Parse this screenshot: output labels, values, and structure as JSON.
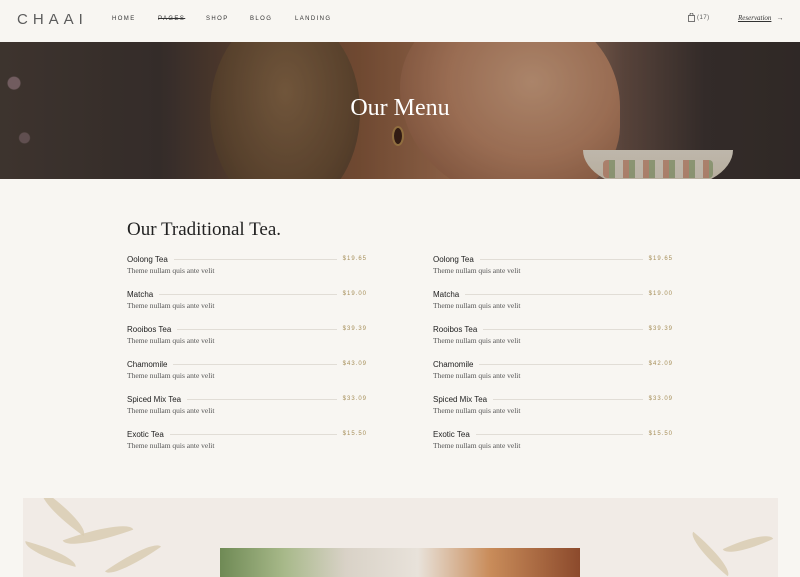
{
  "header": {
    "logo": "CHAAI",
    "nav": {
      "home": "HOME",
      "pages": "PAGES",
      "shop": "SHOP",
      "blog": "BLOG",
      "landing": "LANDING"
    },
    "cart_count": "(17)",
    "reservation": "Reservation",
    "reservation_arrow": "→"
  },
  "hero": {
    "title": "Our Menu"
  },
  "menu": {
    "title": "Our Traditional Tea.",
    "left": [
      {
        "name": "Oolong Tea",
        "price": "$19.65",
        "desc": "Theme nullam quis ante velit"
      },
      {
        "name": "Matcha",
        "price": "$19.00",
        "desc": "Theme nullam quis ante velit"
      },
      {
        "name": "Rooibos Tea",
        "price": "$39.39",
        "desc": "Theme nullam quis ante velit"
      },
      {
        "name": "Chamomile",
        "price": "$43.09",
        "desc": "Theme nullam quis ante velit"
      },
      {
        "name": "Spiced Mix Tea",
        "price": "$33.09",
        "desc": "Theme nullam quis ante velit"
      },
      {
        "name": "Exotic Tea",
        "price": "$15.50",
        "desc": "Theme nullam quis ante velit"
      }
    ],
    "right": [
      {
        "name": "Oolong Tea",
        "price": "$19.65",
        "desc": "Theme nullam quis ante velit"
      },
      {
        "name": "Matcha",
        "price": "$19.00",
        "desc": "Theme nullam quis ante velit"
      },
      {
        "name": "Rooibos Tea",
        "price": "$39.39",
        "desc": "Theme nullam quis ante velit"
      },
      {
        "name": "Chamomile",
        "price": "$42.09",
        "desc": "Theme nullam quis ante velit"
      },
      {
        "name": "Spiced Mix Tea",
        "price": "$33.09",
        "desc": "Theme nullam quis ante velit"
      },
      {
        "name": "Exotic Tea",
        "price": "$15.50",
        "desc": "Theme nullam quis ante velit"
      }
    ]
  },
  "colors": {
    "background": "#f8f6f2",
    "price_accent": "#a68f5a",
    "feature_background": "#f1ebe6"
  },
  "icons": {
    "cart": "shopping-bag-icon"
  }
}
